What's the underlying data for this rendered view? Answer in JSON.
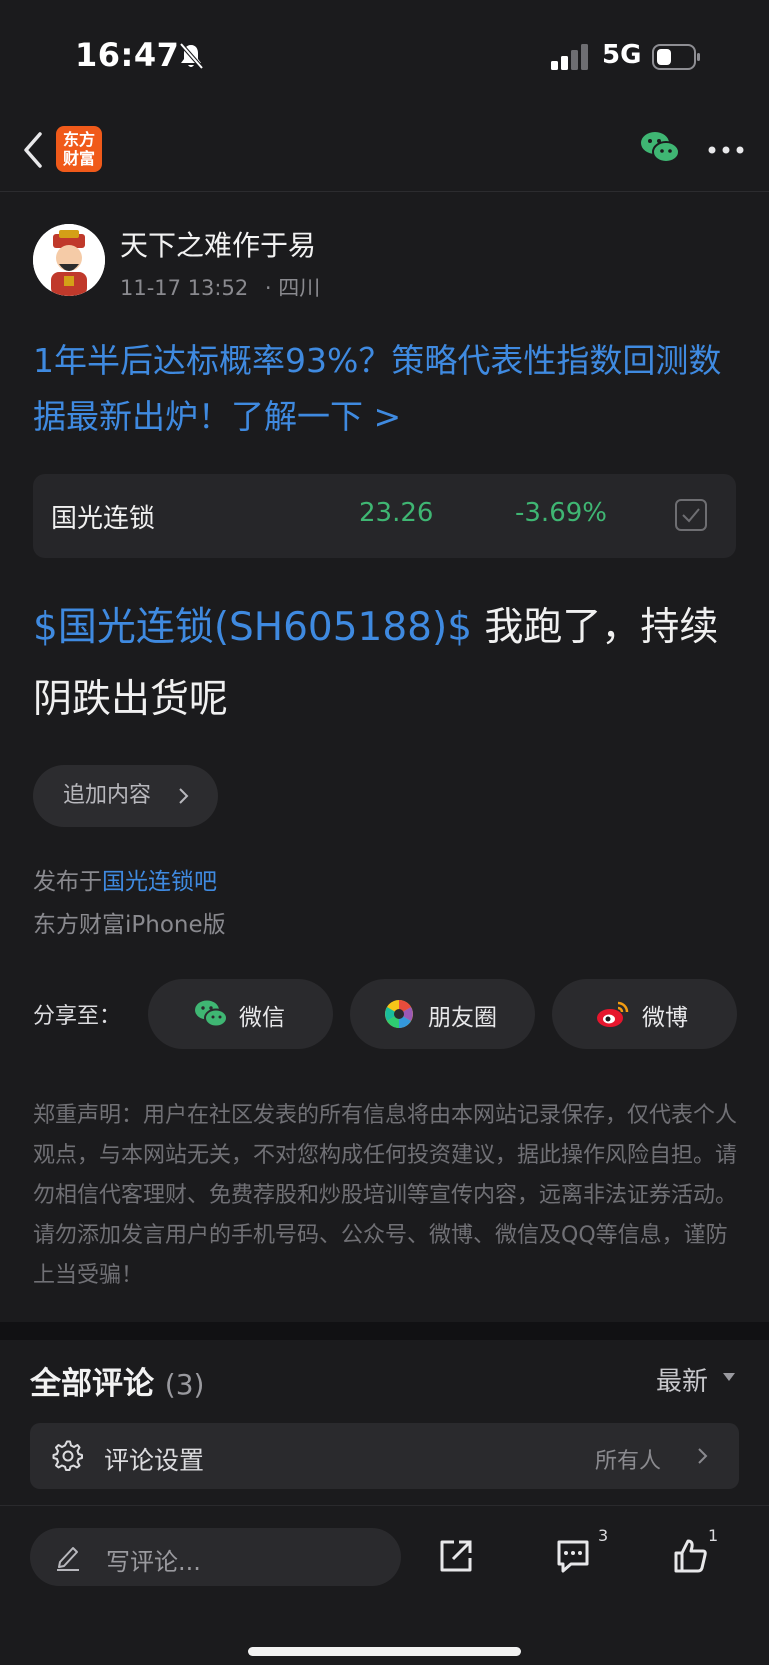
{
  "status_bar": {
    "time": "16:47",
    "network": "5G"
  },
  "nav": {
    "logo_line1": "东方",
    "logo_line2": "财富"
  },
  "author": {
    "name": "天下之难作于易",
    "datetime": "11-17 13:52",
    "location": "· 四川"
  },
  "promo_text": "1年半后达标概率93%？策略代表性指数回测数据最新出炉！了解一下 >",
  "stock": {
    "name": "国光连锁",
    "price": "23.26",
    "change": "-3.69%"
  },
  "post": {
    "stock_link": "$国光连锁(SH605188)$",
    "text": " 我跑了，持续阴跌出货呢"
  },
  "add_content_label": "追加内容",
  "published": {
    "prefix": "发布于",
    "forum": "国光连锁吧",
    "client": "东方财富iPhone版"
  },
  "share": {
    "label": "分享至：",
    "wechat": "微信",
    "moments": "朋友圈",
    "weibo": "微博"
  },
  "disclaimer": "郑重声明：用户在社区发表的所有信息将由本网站记录保存，仅代表个人观点，与本网站无关，不对您构成任何投资建议，据此操作风险自担。请勿相信代客理财、免费荐股和炒股培训等宣传内容，远离非法证券活动。请勿添加发言用户的手机号码、公众号、微博、微信及QQ等信息，谨防上当受骗！",
  "comments": {
    "title": "全部评论",
    "count": "(3)",
    "sort": "最新",
    "settings_label": "评论设置",
    "settings_value": "所有人"
  },
  "bottom_bar": {
    "placeholder": "写评论...",
    "comment_count": "3",
    "like_count": "1"
  },
  "colors": {
    "accent": "#3f8ae0",
    "down_green": "#3fb673",
    "brand": "#f05a1a",
    "background": "#1b1b1d"
  }
}
